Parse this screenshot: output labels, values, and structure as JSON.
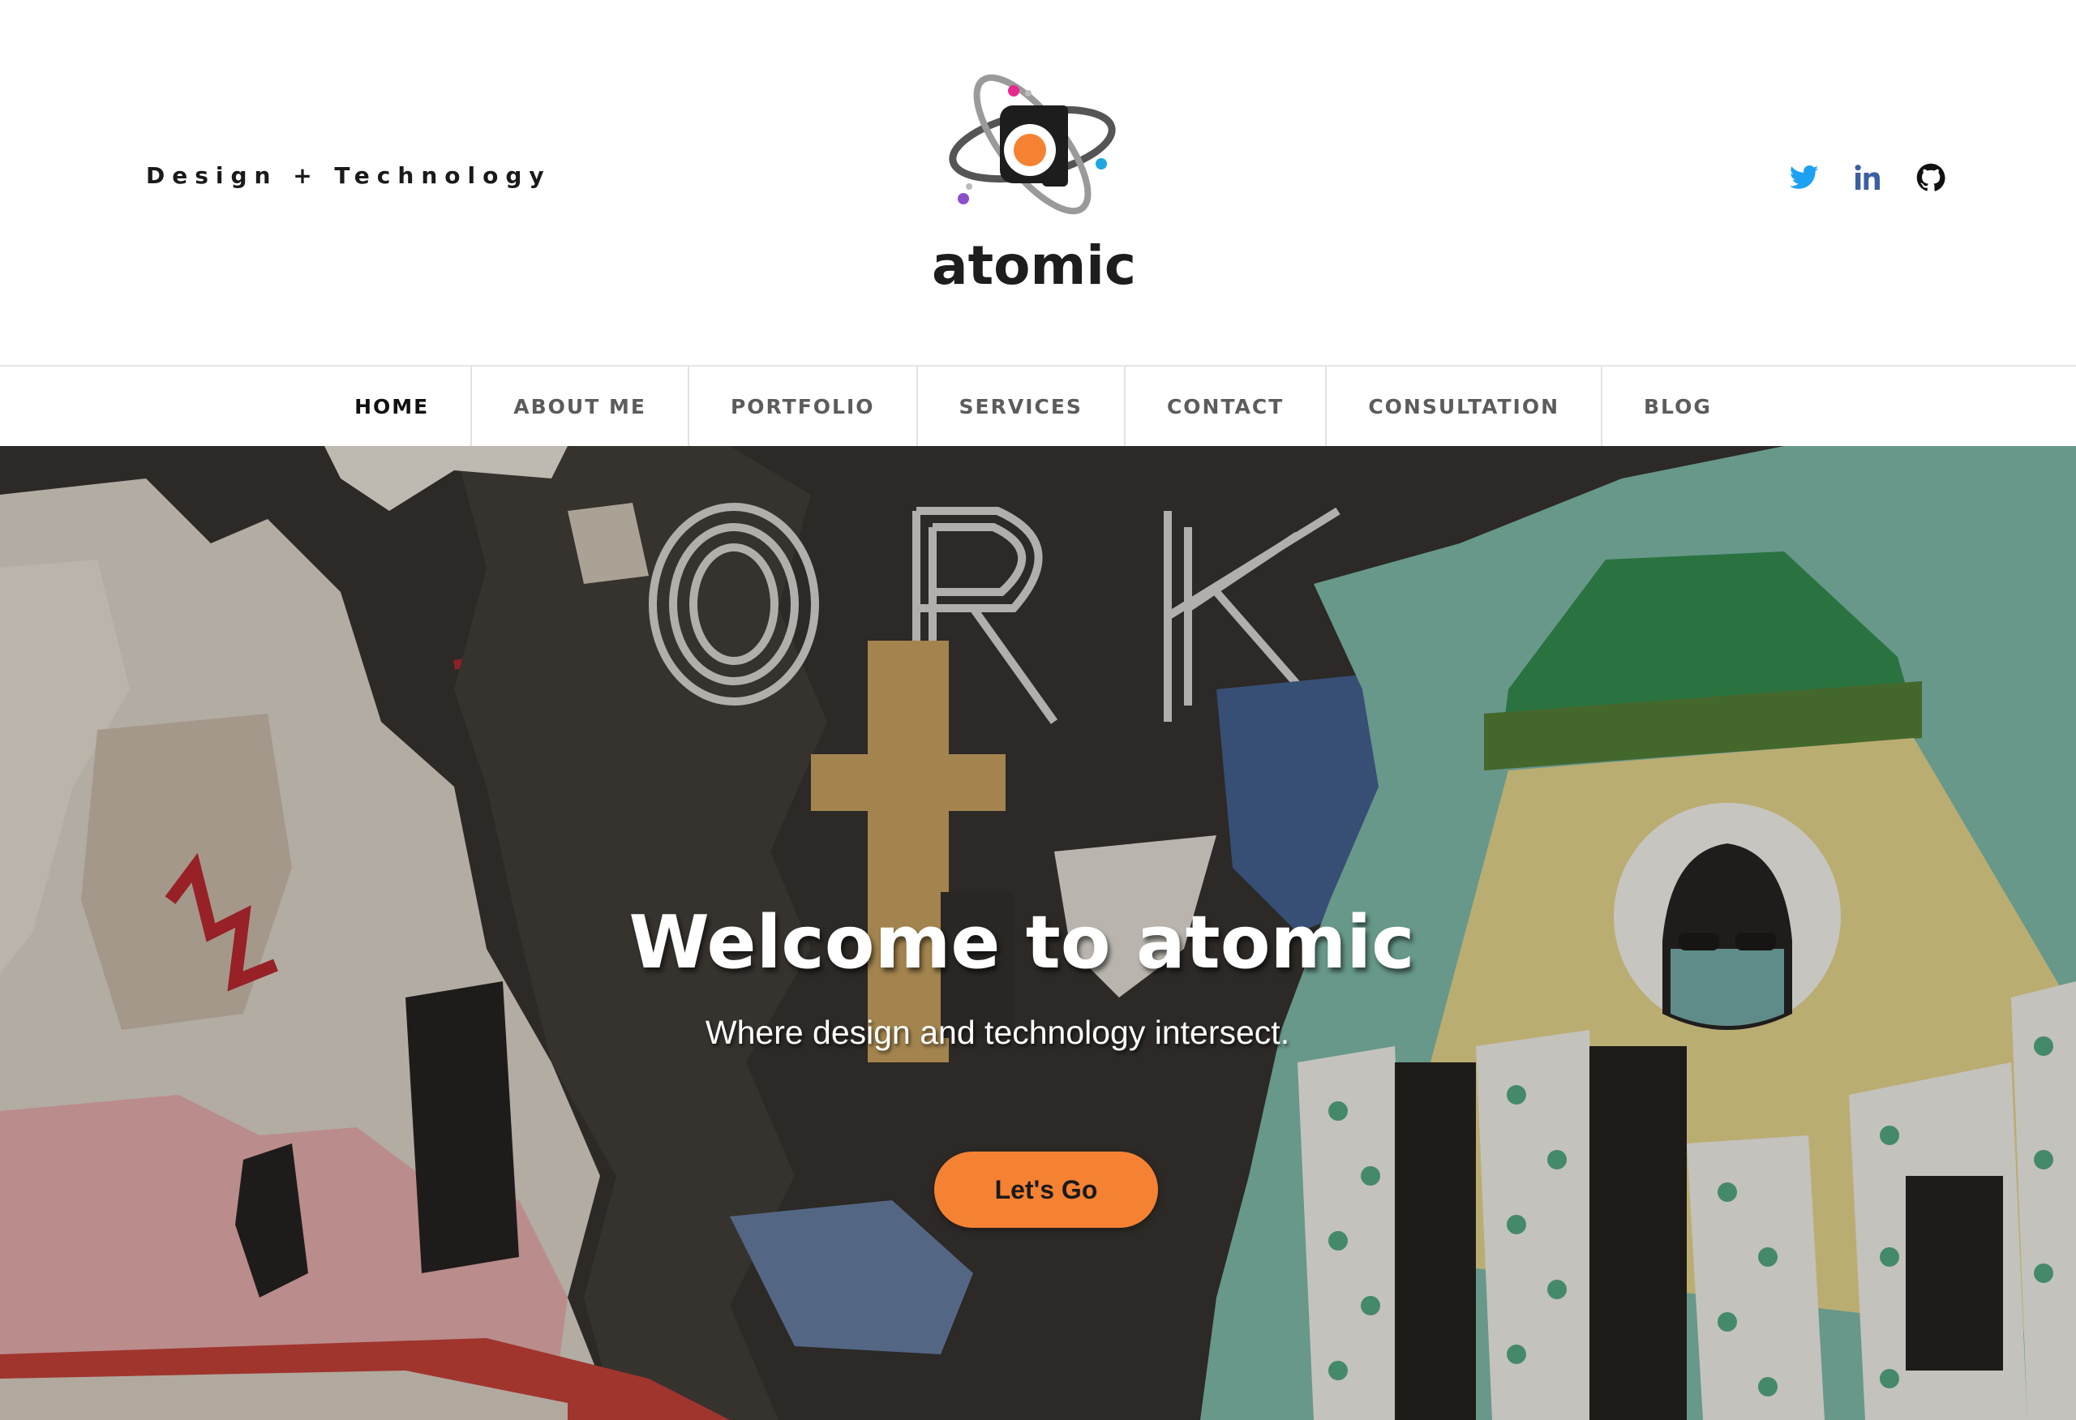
{
  "header": {
    "tagline": "Design + Technology",
    "logo_text": "atomic",
    "social": [
      {
        "icon": "twitter-icon",
        "color": "#1da1f2"
      },
      {
        "icon": "linkedin-icon",
        "color": "#3b5fa0"
      },
      {
        "icon": "github-icon",
        "color": "#111111"
      }
    ]
  },
  "nav": {
    "items": [
      {
        "label": "HOME",
        "active": true
      },
      {
        "label": "ABOUT ME"
      },
      {
        "label": "PORTFOLIO"
      },
      {
        "label": "SERVICES"
      },
      {
        "label": "CONTACT"
      },
      {
        "label": "CONSULTATION"
      },
      {
        "label": "BLOG"
      }
    ]
  },
  "hero": {
    "title": "Welcome to atomic",
    "subtitle": "Where design and technology intersect.",
    "cta_label": "Let's Go",
    "cta_color": "#f58232"
  },
  "colors": {
    "accent_orange": "#f58232",
    "logo_pink": "#e6288c",
    "logo_blue": "#1fa6e0",
    "logo_purple": "#8a4fc9"
  }
}
